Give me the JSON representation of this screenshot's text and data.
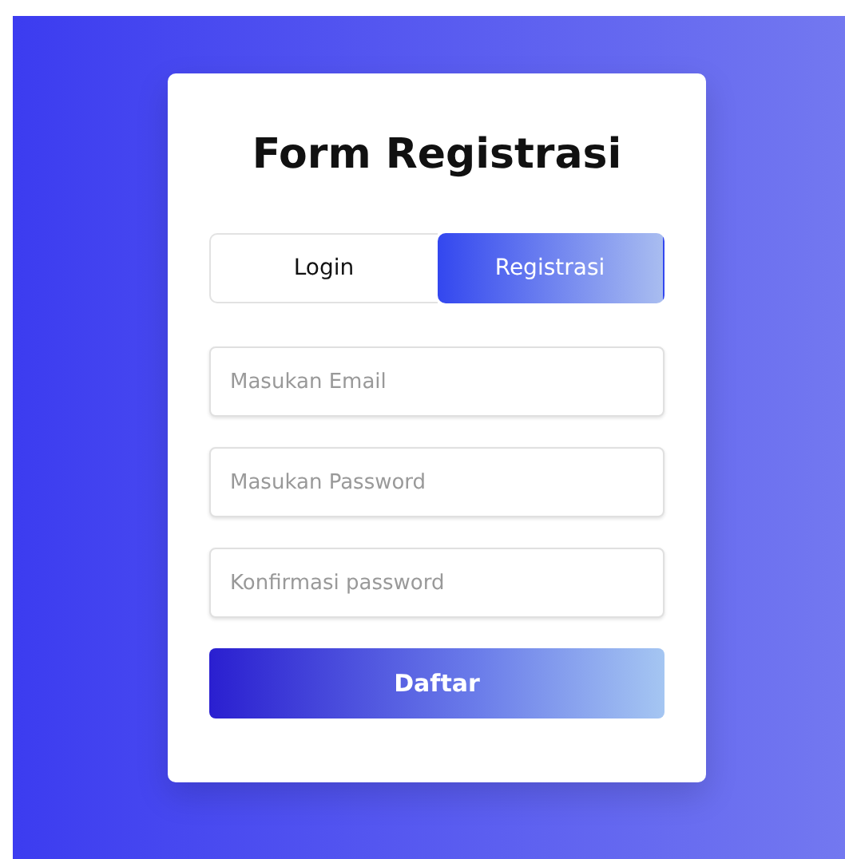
{
  "title": "Form Registrasi",
  "tabs": [
    {
      "label": "Login",
      "selected": false
    },
    {
      "label": "Registrasi",
      "selected": true
    }
  ],
  "fields": [
    {
      "placeholder": "Masukan Email"
    },
    {
      "placeholder": "Masukan Password"
    },
    {
      "placeholder": "Konfirmasi password"
    }
  ],
  "submit": "Daftar"
}
